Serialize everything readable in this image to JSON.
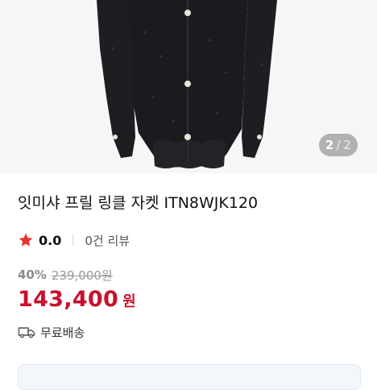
{
  "gallery": {
    "current_page": "2",
    "separator": "/",
    "total_pages": "2"
  },
  "product": {
    "title": "잇미샤 프릴 링클 자켓 ITN8WJK120",
    "rating": "0.0",
    "review_count": "0건 리뷰",
    "discount_rate": "40%",
    "original_price": "239,000원",
    "sale_price": "143,400",
    "currency": "원",
    "shipping": "무료배송"
  },
  "icons": {
    "rating": "star-icon",
    "shipping": "truck-icon"
  },
  "colors": {
    "accent_price": "#c8102e",
    "star": "#e8322b",
    "gallery_bg": "#f6f6f6"
  }
}
